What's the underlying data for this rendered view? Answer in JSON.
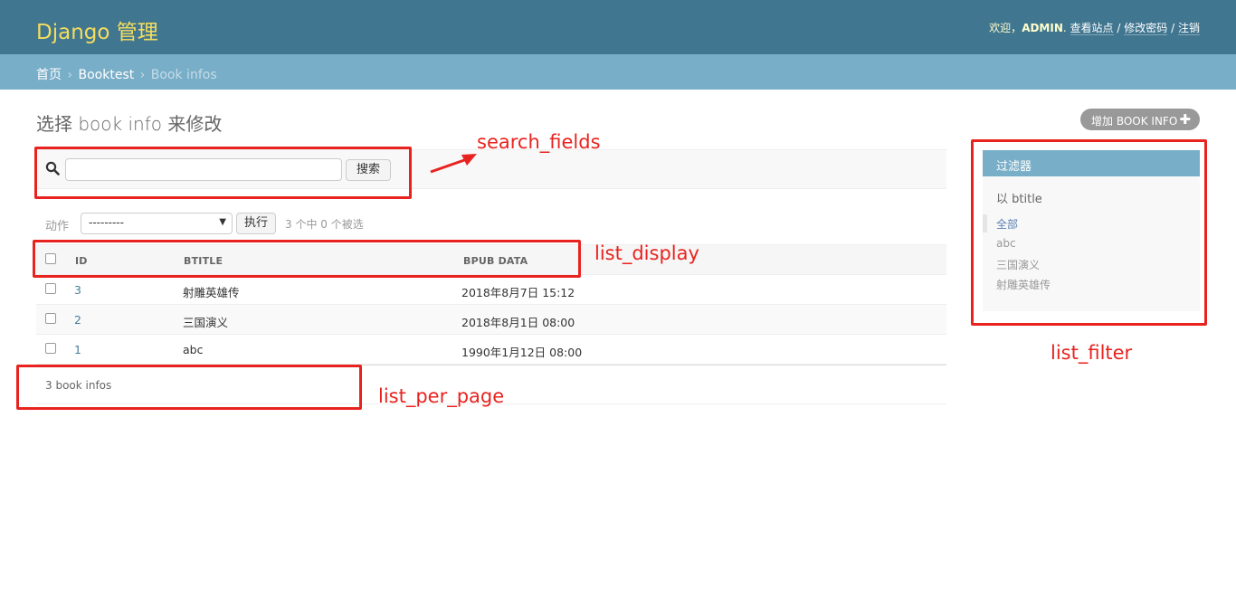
{
  "header": {
    "brand": "Django 管理",
    "welcome": "欢迎，",
    "username": "ADMIN",
    "username_suffix": ".",
    "view_site": "查看站点",
    "separator": "/",
    "change_password": "修改密码",
    "logout": "注销"
  },
  "breadcrumbs": {
    "home": "首页",
    "arrow": "›",
    "app": "Booktest",
    "current": "Book infos"
  },
  "page": {
    "title": "选择 book info 来修改",
    "add_button": "增加 BOOK INFO",
    "add_icon": "plus-icon"
  },
  "search": {
    "icon": "search-icon",
    "value": "",
    "placeholder": "",
    "button": "搜索"
  },
  "actions": {
    "label": "动作",
    "selected_option": "---------",
    "run_button": "执行",
    "selected_count": "3 个中 0 个被选"
  },
  "table": {
    "columns": [
      "ID",
      "BTITLE",
      "BPUB DATA"
    ],
    "rows": [
      {
        "id": "3",
        "btitle": "射雕英雄传",
        "bpub_data": "2018年8月7日 15:12"
      },
      {
        "id": "2",
        "btitle": "三国演义",
        "bpub_data": "2018年8月1日 08:00"
      },
      {
        "id": "1",
        "btitle": "abc",
        "bpub_data": "1990年1月12日 08:00"
      }
    ],
    "paginator": "3 book infos"
  },
  "filter": {
    "title": "过滤器",
    "by": "以 btitle",
    "items": [
      "全部",
      "abc",
      "三国演义",
      "射雕英雄传"
    ],
    "selected": "全部"
  },
  "annotations": {
    "search_fields": "search_fields",
    "list_display": "list_display",
    "list_per_page": "list_per_page",
    "list_filter": "list_filter"
  },
  "colors": {
    "header_bg": "#417690",
    "brand": "#f5dd5d",
    "breadcrumbs_bg": "#79aec8",
    "annotation": "#e8231f",
    "link": "#447e9b"
  }
}
